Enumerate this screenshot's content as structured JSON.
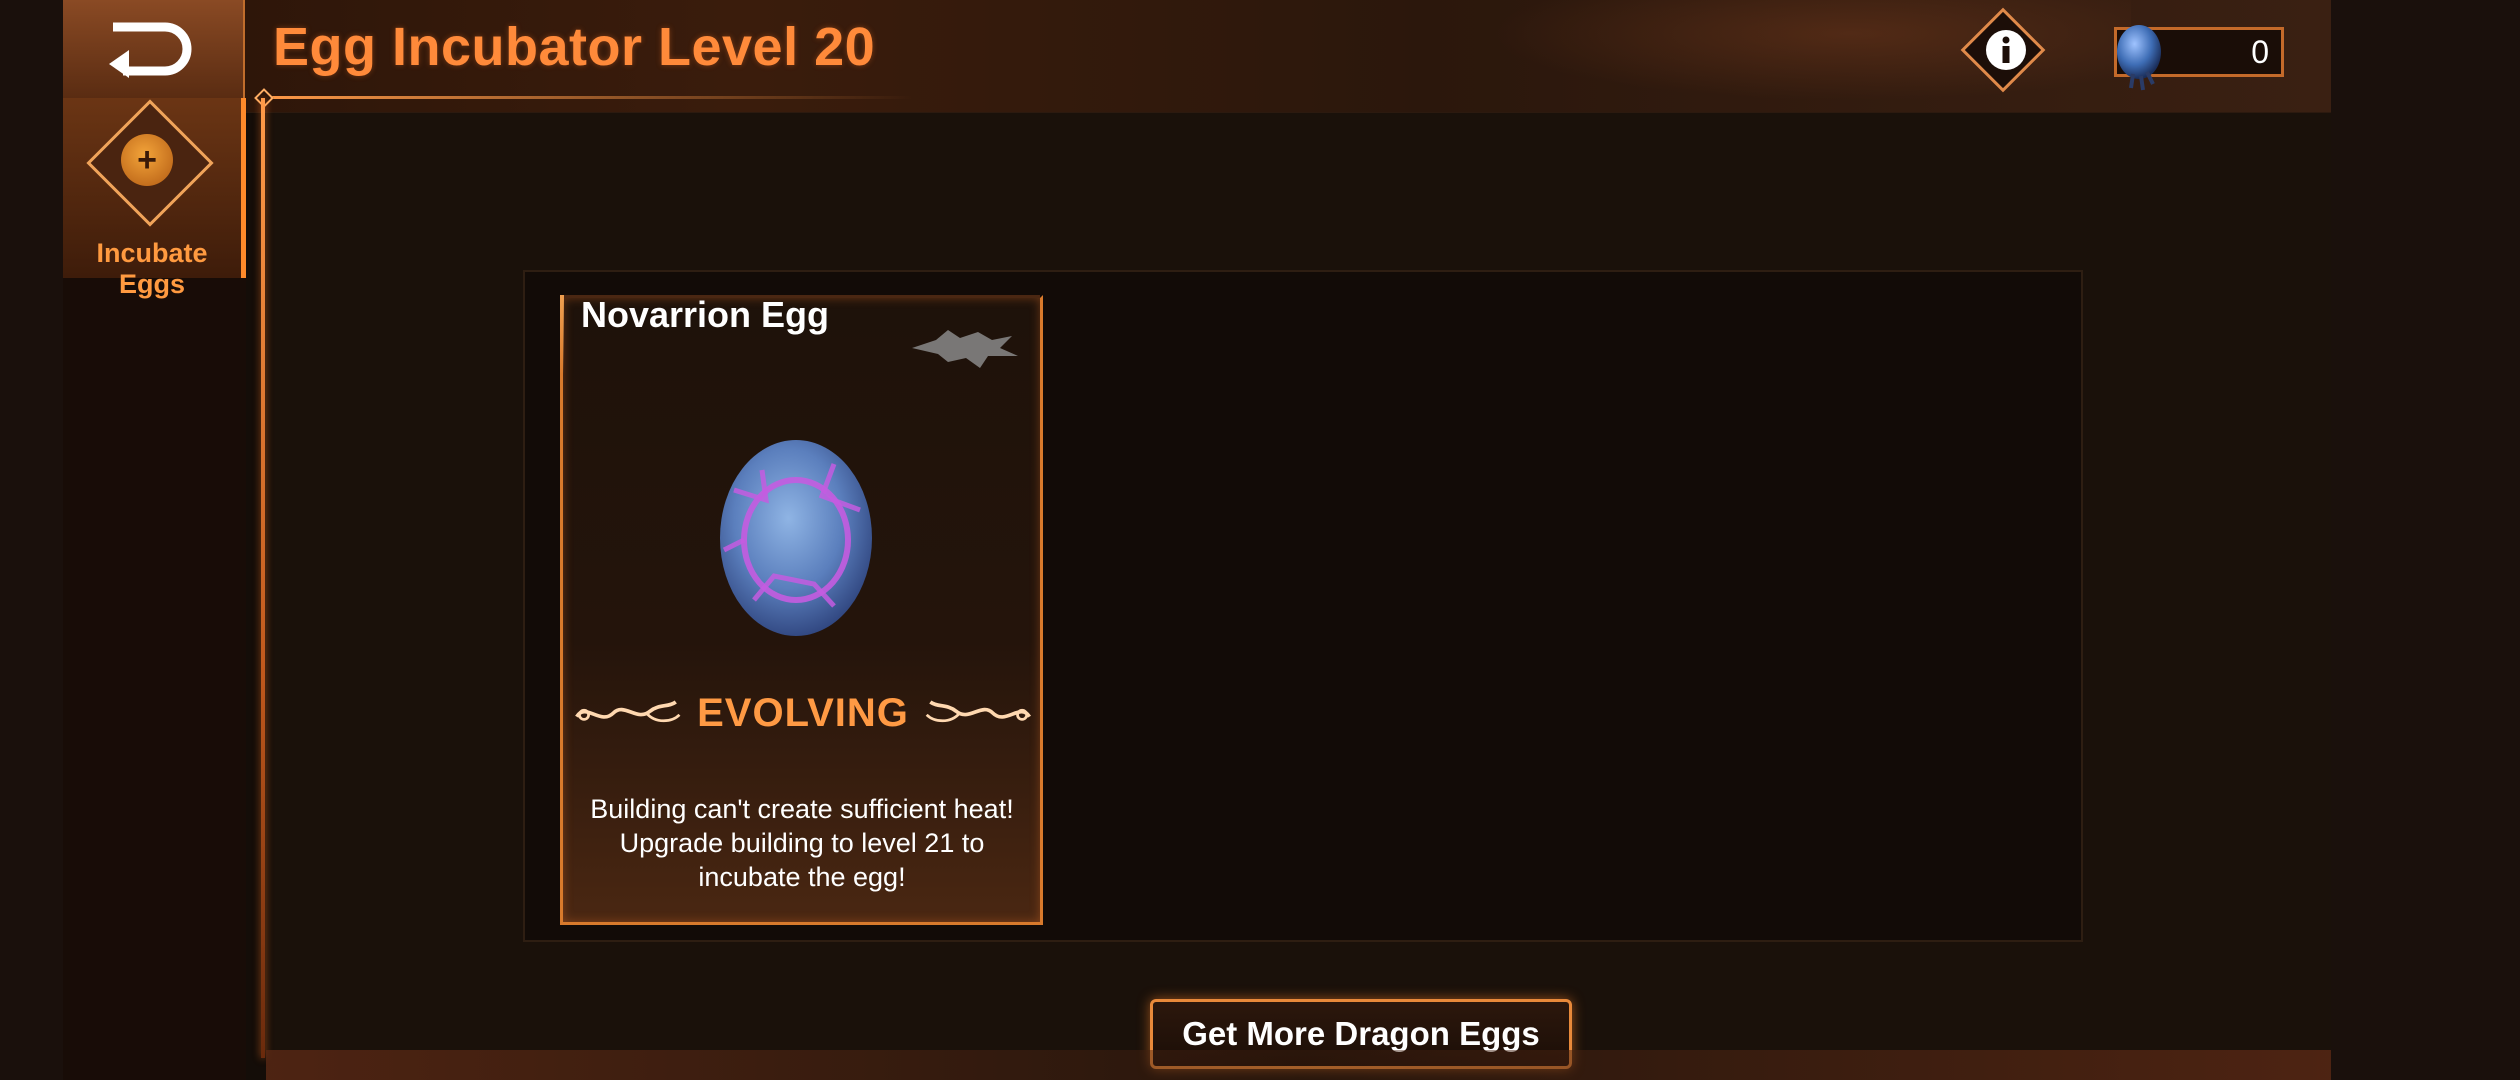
{
  "header": {
    "title": "Egg Incubator Level 20",
    "back_icon": "back-arrow-icon",
    "info_icon": "info-icon",
    "currency_icon": "dragon-egg-icon",
    "currency_value": "0"
  },
  "sidebar": {
    "items": [
      {
        "label": "Incubate Eggs",
        "icon": "plus-coin-icon",
        "active": true
      }
    ]
  },
  "egg_card": {
    "name": "Novarrion Egg",
    "dragon_icon": "dragon-silhouette-icon",
    "egg_icon": "blue-egg-icon",
    "status": "EVOLVING",
    "message": "Building can't create sufficient heat! Upgrade building to level 21 to incubate the egg!"
  },
  "footer": {
    "get_more_label": "Get More Dragon Eggs"
  },
  "colors": {
    "accent": "#ff8a3a",
    "border": "#d87a2c",
    "background": "#140d08"
  }
}
